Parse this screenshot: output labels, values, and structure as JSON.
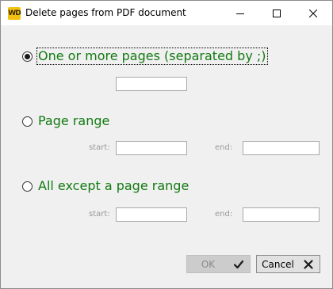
{
  "window": {
    "title": "Delete pages from PDF document",
    "app_icon_text": "WD",
    "controls": [
      "minimize-icon",
      "maximize-icon",
      "close-icon"
    ]
  },
  "options": {
    "one_or_more": {
      "label": "One or more pages (separated by ;)",
      "checked": true,
      "pages_value": ""
    },
    "page_range": {
      "label": "Page range",
      "checked": false,
      "start_label": "start:",
      "end_label": "end:",
      "start_value": "",
      "end_value": ""
    },
    "all_except": {
      "label": "All except a page range",
      "checked": false,
      "start_label": "start:",
      "end_label": "end:",
      "start_value": "",
      "end_value": ""
    }
  },
  "buttons": {
    "ok_label": "OK",
    "ok_icon": "checkmark-icon",
    "ok_enabled": false,
    "cancel_label": "Cancel",
    "cancel_icon": "x-icon"
  },
  "colors": {
    "option_label": "#117a11",
    "field_label": "#9a9a9a"
  }
}
